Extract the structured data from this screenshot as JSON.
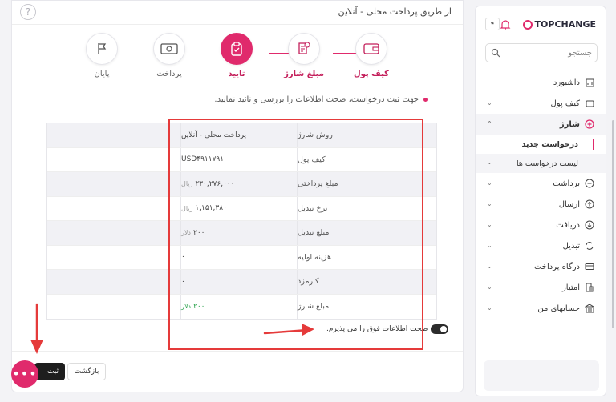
{
  "header": {
    "title": "از طریق پرداخت محلی - آنلاین",
    "help_glyph": "?"
  },
  "stepper": [
    {
      "label": "کیف پول",
      "state": "done"
    },
    {
      "label": "مبلغ شارژ",
      "state": "done"
    },
    {
      "label": "تایید",
      "state": "current"
    },
    {
      "label": "پرداخت",
      "state": "pending"
    },
    {
      "label": "پایان",
      "state": "pending"
    }
  ],
  "note": "جهت ثبت درخواست، صحت اطلاعات را بررسی و تائید نمایید.",
  "table": [
    {
      "label": "روش شارژ",
      "value": "پرداخت محلی - آنلاین",
      "unit": "",
      "green": false
    },
    {
      "label": "کیف پول",
      "value": "USD۴۹۱۱۷۹۱",
      "unit": "",
      "green": false
    },
    {
      "label": "مبلغ پرداختی",
      "value": "۲۳۰,۲۷۶,۰۰۰",
      "unit": "ریال",
      "green": false
    },
    {
      "label": "نرخ تبدیل",
      "value": "۱,۱۵۱,۳۸۰",
      "unit": "ریال",
      "green": false
    },
    {
      "label": "مبلغ تبدیل",
      "value": "۲۰۰",
      "unit": "دلار",
      "green": false
    },
    {
      "label": "هزینه اولیه",
      "value": "۰",
      "unit": "",
      "green": false
    },
    {
      "label": "کارمزد",
      "value": "۰",
      "unit": "",
      "green": false
    },
    {
      "label": "مبلغ شارژ",
      "value": "۲۰۰",
      "unit": "دلار",
      "green": true
    }
  ],
  "accept_text": "صحت اطلاعات فوق را می پذیرم.",
  "buttons": {
    "back": "بازگشت",
    "next": "ثبت"
  },
  "chat_glyph": "•••",
  "sidebar": {
    "logo": "TOPCHANGE",
    "notif_count": "۴",
    "search_placeholder": "جستجو",
    "items": [
      {
        "label": "داشبورد",
        "icon": "dashboard-icon",
        "chevron": false
      },
      {
        "label": "کیف پول",
        "icon": "wallet-icon",
        "chevron": true
      },
      {
        "label": "شارژ",
        "icon": "plus-circle-icon",
        "chevron": true,
        "active": true
      },
      {
        "label": "برداشت",
        "icon": "minus-circle-icon",
        "chevron": true
      },
      {
        "label": "ارسال",
        "icon": "arrow-up-icon",
        "chevron": true
      },
      {
        "label": "دریافت",
        "icon": "arrow-down-icon",
        "chevron": true
      },
      {
        "label": "تبدیل",
        "icon": "exchange-icon",
        "chevron": true
      },
      {
        "label": "درگاه پرداخت",
        "icon": "card-icon",
        "chevron": true
      },
      {
        "label": "امتیاز",
        "icon": "points-icon",
        "chevron": true
      },
      {
        "label": "حسابهای من",
        "icon": "bank-icon",
        "chevron": true
      }
    ],
    "sub_new": "درخواست جدید",
    "sub_list": "لیست درخواست ها"
  },
  "colors": {
    "accent": "#e02a6c",
    "annotation": "#e53a3a",
    "green": "#2ea44f"
  }
}
